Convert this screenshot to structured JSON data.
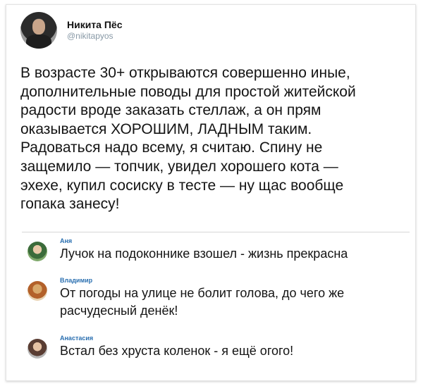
{
  "author": {
    "display_name": "Никита Пёс",
    "handle": "@nikitapyos"
  },
  "tweet": {
    "text": "В возрасте 30+ открываются совершенно иные,\nдополнительные поводы для простой житейской\nрадости вроде заказать стеллаж, а он прям\nоказывается ХОРОШИМ, ЛАДНЫМ таким.\nРадоваться надо всему, я считаю. Спину не\nзащемило — топчик, увидел хорошего кота —\nэхехе, купил сосиску в тесте — ну щас вообще\nгопака занесу!"
  },
  "replies": [
    {
      "name": "Аня",
      "text": "Лучок на подоконнике взошел - жизнь прекрасна"
    },
    {
      "name": "Владимир",
      "text": "От погоды на улице не болит голова, до чего же\nрасчудесный денёк!"
    },
    {
      "name": "Анастасия",
      "text": "Встал без хруста коленок - я ещё огого!"
    }
  ]
}
